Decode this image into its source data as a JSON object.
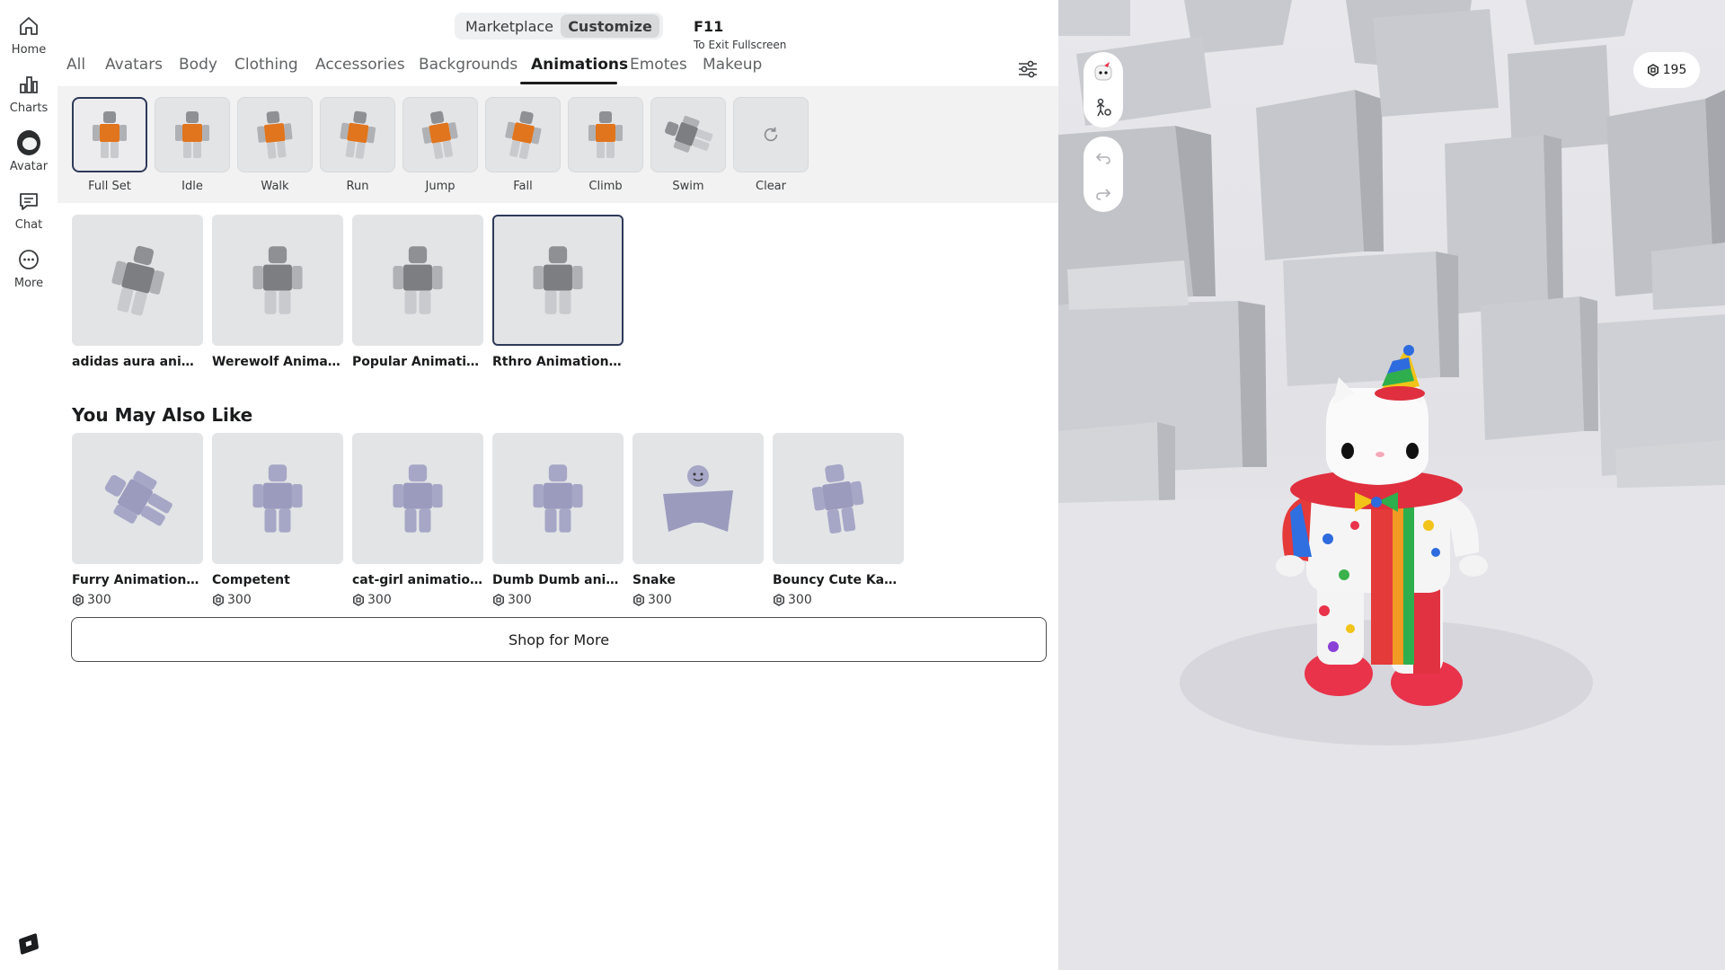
{
  "nav": {
    "items": [
      {
        "label": "Home",
        "icon": "home-icon"
      },
      {
        "label": "Charts",
        "icon": "charts-icon"
      },
      {
        "label": "Avatar",
        "icon": "avatar-icon"
      },
      {
        "label": "Chat",
        "icon": "chat-icon"
      },
      {
        "label": "More",
        "icon": "more-icon"
      }
    ]
  },
  "header": {
    "toggle": {
      "marketplace": "Marketplace",
      "customize": "Customize",
      "selected": "Customize"
    },
    "fullscreen": {
      "key": "F11",
      "hint": "To Exit Fullscreen"
    }
  },
  "tabs": [
    "All",
    "Avatars",
    "Body",
    "Clothing",
    "Accessories",
    "Backgrounds",
    "Animations",
    "Emotes",
    "Makeup"
  ],
  "active_tab": "Animations",
  "anim_slots": [
    {
      "label": "Full Set",
      "selected": true
    },
    {
      "label": "Idle"
    },
    {
      "label": "Walk"
    },
    {
      "label": "Run"
    },
    {
      "label": "Jump"
    },
    {
      "label": "Fall"
    },
    {
      "label": "Climb"
    },
    {
      "label": "Swim"
    },
    {
      "label": "Clear"
    }
  ],
  "owned": [
    {
      "name": "adidas aura animati..."
    },
    {
      "name": "Werewolf Animatio..."
    },
    {
      "name": "Popular Animation ..."
    },
    {
      "name": "Rthro Animation Pa...",
      "selected": true
    }
  ],
  "recommend": {
    "title": "You May Also Like",
    "items": [
      {
        "name": "Furry Animation Pa...",
        "price": "300"
      },
      {
        "name": "Competent",
        "price": "300"
      },
      {
        "name": "cat-girl animation ...",
        "price": "300"
      },
      {
        "name": "Dumb Dumb anima...",
        "price": "300"
      },
      {
        "name": "Snake",
        "price": "300"
      },
      {
        "name": "Bouncy Cute Kawaii",
        "price": "300"
      }
    ]
  },
  "shop_more": "Shop for More",
  "preview": {
    "balance": "195"
  },
  "colors": {
    "accent": "#1b1c1d",
    "selected_border": "#2d3a5a",
    "tile": "#e3e4e6"
  }
}
